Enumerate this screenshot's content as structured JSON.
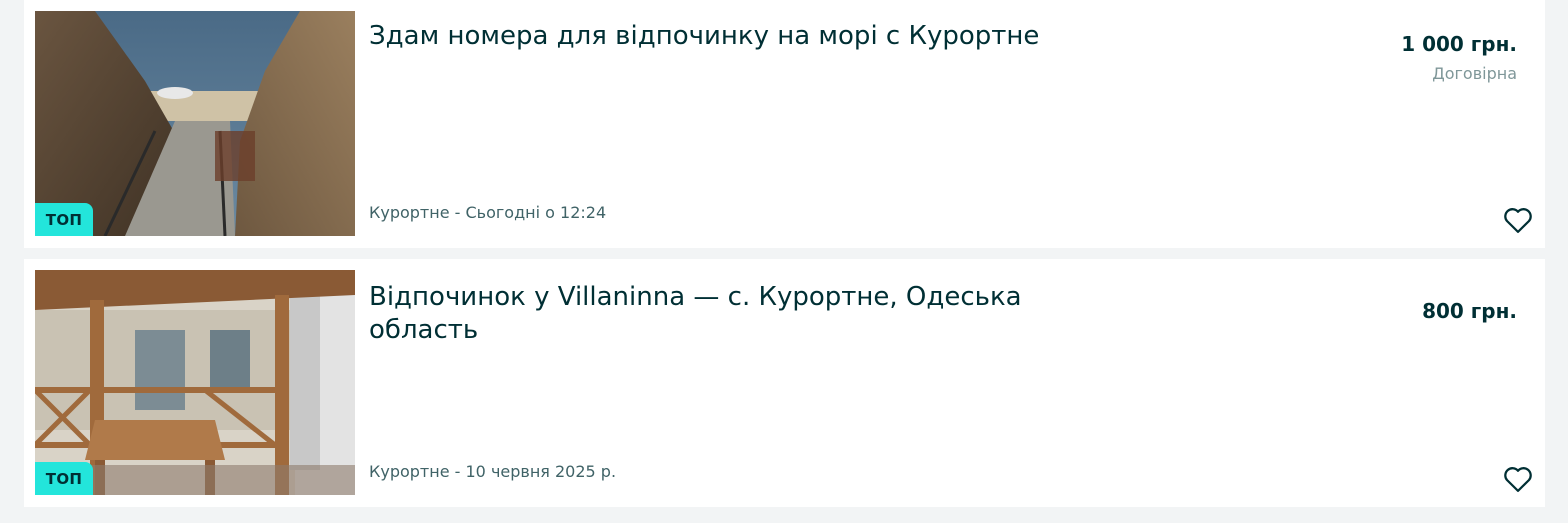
{
  "listings": [
    {
      "title": "Здам номера для відпочинку на морі с Курортне",
      "location_date": "Курортне - Сьогодні о 12:24",
      "price": "1 000 грн.",
      "price_note": "Договірна",
      "badge": "ТОП",
      "image": "beach-stairs-photo",
      "favorite_icon": "heart-outline-icon"
    },
    {
      "title": "Відпочинок у Villaninna — с. Курортне, Одеська область",
      "location_date": "Курортне - 10 червня 2025 р.",
      "price": "800 грн.",
      "badge": "ТОП",
      "image": "wooden-pergola-photo",
      "favorite_icon": "heart-outline-icon"
    }
  ],
  "colors": {
    "badge_bg": "#23e5db",
    "text_primary": "#002f34",
    "text_secondary": "#406367",
    "card_bg": "#ffffff",
    "page_bg": "#f2f4f5"
  }
}
